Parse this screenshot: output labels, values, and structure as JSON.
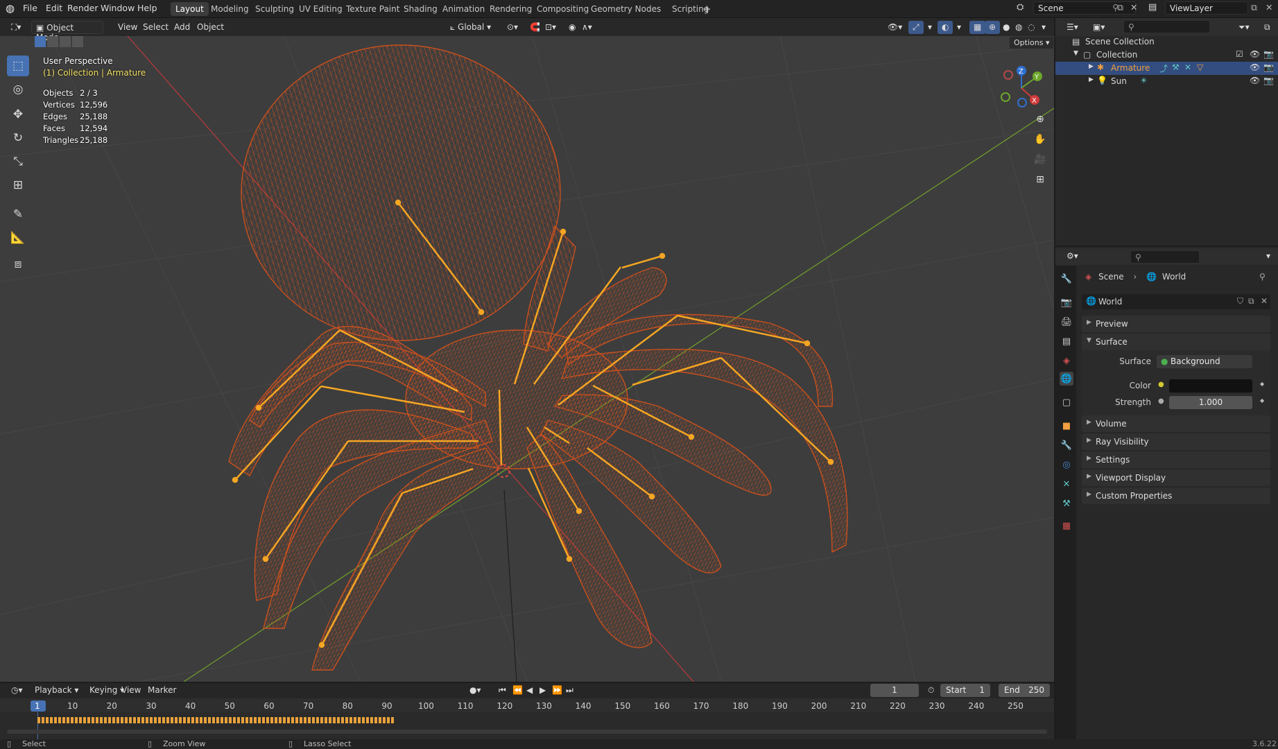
{
  "app": {
    "menu": [
      "File",
      "Edit",
      "Render",
      "Window",
      "Help"
    ],
    "workspace_tabs": [
      "Layout",
      "Modeling",
      "Sculpting",
      "UV Editing",
      "Texture Paint",
      "Shading",
      "Animation",
      "Rendering",
      "Compositing",
      "Geometry Nodes",
      "Scripting"
    ],
    "active_tab": "Layout",
    "scene_name": "Scene",
    "view_layer_name": "ViewLayer",
    "version": "3.6.22"
  },
  "viewport": {
    "mode": "Object Mode",
    "menus": [
      "View",
      "Select",
      "Add",
      "Object"
    ],
    "orientation": "Global",
    "options_label": "Options",
    "perspective_label": "User Perspective",
    "context_label": "(1) Collection | Armature",
    "stats": [
      {
        "label": "Objects",
        "value": "2 / 3"
      },
      {
        "label": "Vertices",
        "value": "12,596"
      },
      {
        "label": "Edges",
        "value": "25,188"
      },
      {
        "label": "Faces",
        "value": "12,594"
      },
      {
        "label": "Triangles",
        "value": "25,188"
      }
    ],
    "gizmo_axes": [
      "Z",
      "Y",
      "X"
    ],
    "colors": {
      "background": "#3d3d3d",
      "wireframe": "#c9501e",
      "bones": "#f5a623",
      "x_axis": "#b33a3a",
      "y_axis": "#6f9a2b"
    }
  },
  "outliner": {
    "root": "Scene Collection",
    "collection": "Collection",
    "items": [
      {
        "name": "Armature",
        "selected": true
      },
      {
        "name": "Sun",
        "selected": false
      }
    ]
  },
  "properties": {
    "breadcrumb": [
      "Scene",
      "World"
    ],
    "world_name": "World",
    "panels": {
      "preview": "Preview",
      "surface": "Surface",
      "volume": "Volume",
      "ray_visibility": "Ray Visibility",
      "settings": "Settings",
      "viewport_display": "Viewport Display",
      "custom_properties": "Custom Properties"
    },
    "surface": {
      "surface_label": "Surface",
      "surface_value": "Background",
      "color_label": "Color",
      "color_value": "#111111",
      "strength_label": "Strength",
      "strength_value": "1.000"
    }
  },
  "timeline": {
    "menus": [
      "Playback",
      "Keying",
      "View",
      "Marker"
    ],
    "current_frame": "1",
    "start_label": "Start",
    "start_value": "1",
    "end_label": "End",
    "end_value": "250",
    "ticks": [
      "1",
      "10",
      "20",
      "30",
      "40",
      "50",
      "60",
      "70",
      "80",
      "90",
      "100",
      "110",
      "120",
      "130",
      "140",
      "150",
      "160",
      "170",
      "180",
      "190",
      "200",
      "210",
      "220",
      "230",
      "240",
      "250"
    ]
  },
  "statusbar": {
    "items": [
      "Select",
      "Zoom View",
      "Lasso Select"
    ]
  }
}
